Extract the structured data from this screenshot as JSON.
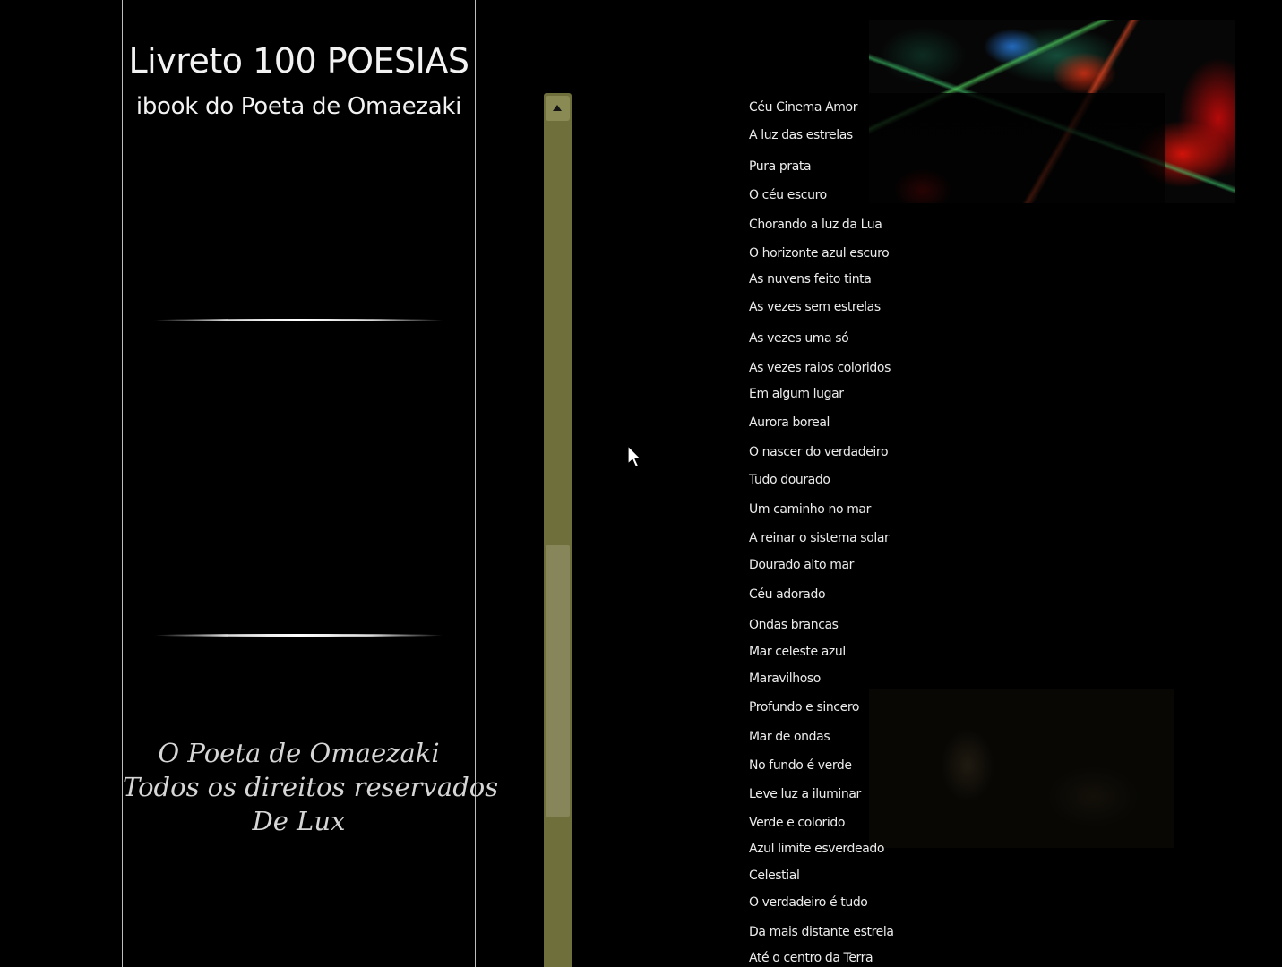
{
  "header": {
    "title": "Livreto 100 POESIAS",
    "subtitle": "ibook do Poeta de Omaezaki"
  },
  "credits": {
    "line1": "O Poeta de Omaezaki",
    "line2": "Todos os direitos reservados",
    "line3": "De  Lux"
  },
  "scrollbar": {
    "up_icon": "triangle-up-icon",
    "thumb_color": "#86865a",
    "track_color": "#6f6f3c"
  },
  "poems": [
    "Céu Cinema Amor",
    "A luz das estrelas",
    "Pura prata",
    "O céu escuro",
    "Chorando a luz da Lua",
    "O horizonte azul escuro",
    "As nuvens feito tinta",
    "As vezes sem estrelas",
    "As vezes uma só",
    "As vezes raios coloridos",
    "Em algum lugar",
    "Aurora boreal",
    "O nascer do verdadeiro",
    "Tudo dourado",
    "Um caminho no mar",
    "A reinar o sistema solar",
    "Dourado alto mar",
    "Céu adorado",
    "Ondas brancas",
    "Mar celeste azul",
    "Maravilhoso",
    "Profundo e sincero",
    "Mar de ondas",
    "No fundo é verde",
    "Leve luz a iluminar",
    "Verde e colorido",
    "Azul limite esverdeado",
    "Celestial",
    "O verdadeiro é tudo",
    "Da mais distante estrela",
    "Até o centro da Terra"
  ]
}
